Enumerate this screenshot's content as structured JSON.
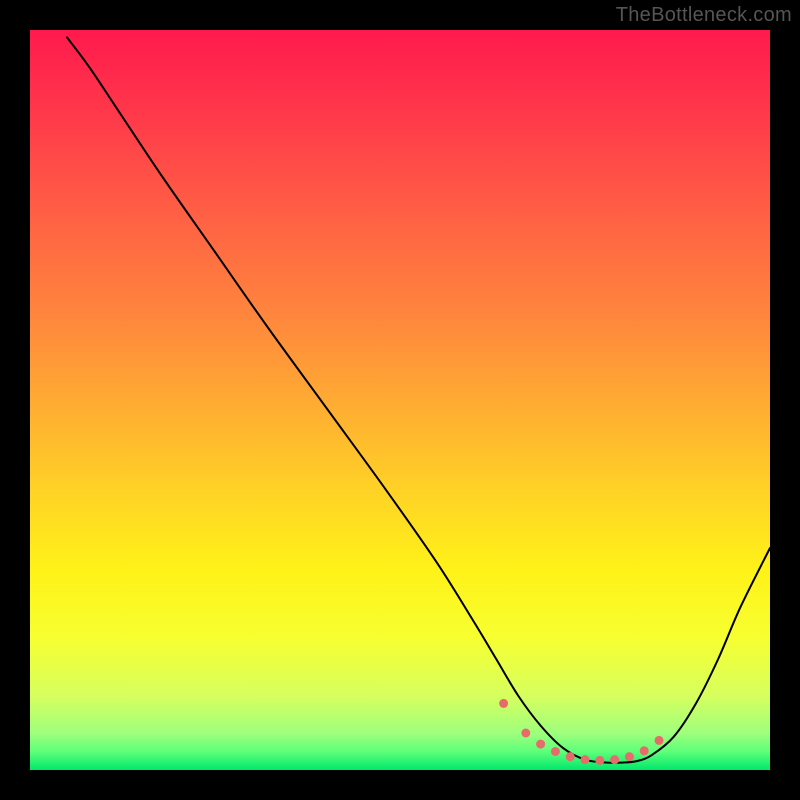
{
  "watermark": "TheBottleneck.com",
  "chart_data": {
    "type": "line",
    "title": "",
    "xlabel": "",
    "ylabel": "",
    "xlim": [
      0,
      100
    ],
    "ylim": [
      0,
      100
    ],
    "background_gradient": {
      "stops": [
        {
          "offset": 0.0,
          "color": "#ff1a4d"
        },
        {
          "offset": 0.12,
          "color": "#ff3a4a"
        },
        {
          "offset": 0.25,
          "color": "#ff6044"
        },
        {
          "offset": 0.38,
          "color": "#ff843d"
        },
        {
          "offset": 0.5,
          "color": "#ffaa33"
        },
        {
          "offset": 0.62,
          "color": "#ffd126"
        },
        {
          "offset": 0.73,
          "color": "#fff218"
        },
        {
          "offset": 0.82,
          "color": "#f7ff30"
        },
        {
          "offset": 0.9,
          "color": "#d6ff5e"
        },
        {
          "offset": 0.95,
          "color": "#9fff7c"
        },
        {
          "offset": 0.975,
          "color": "#5eff7a"
        },
        {
          "offset": 1.0,
          "color": "#00e86b"
        }
      ]
    },
    "series": [
      {
        "name": "bottleneck-curve",
        "color": "#000000",
        "width": 2,
        "x": [
          5,
          8,
          12,
          18,
          25,
          32,
          40,
          48,
          55,
          60,
          63,
          66,
          69,
          72,
          75,
          78,
          80,
          82,
          84,
          87,
          90,
          93,
          96,
          100
        ],
        "values": [
          99,
          95,
          89,
          80,
          70,
          60,
          49,
          38,
          28,
          20,
          15,
          10,
          6,
          3,
          1.4,
          1,
          1,
          1.2,
          2,
          4.5,
          9,
          15,
          22,
          30
        ]
      }
    ],
    "markers": {
      "name": "highlight-dots",
      "color": "#e86b6b",
      "radius": 4.5,
      "x": [
        64,
        67,
        69,
        71,
        73,
        75,
        77,
        79,
        81,
        83,
        85
      ],
      "values": [
        9,
        5,
        3.5,
        2.5,
        1.8,
        1.4,
        1.3,
        1.4,
        1.8,
        2.6,
        4
      ]
    }
  }
}
